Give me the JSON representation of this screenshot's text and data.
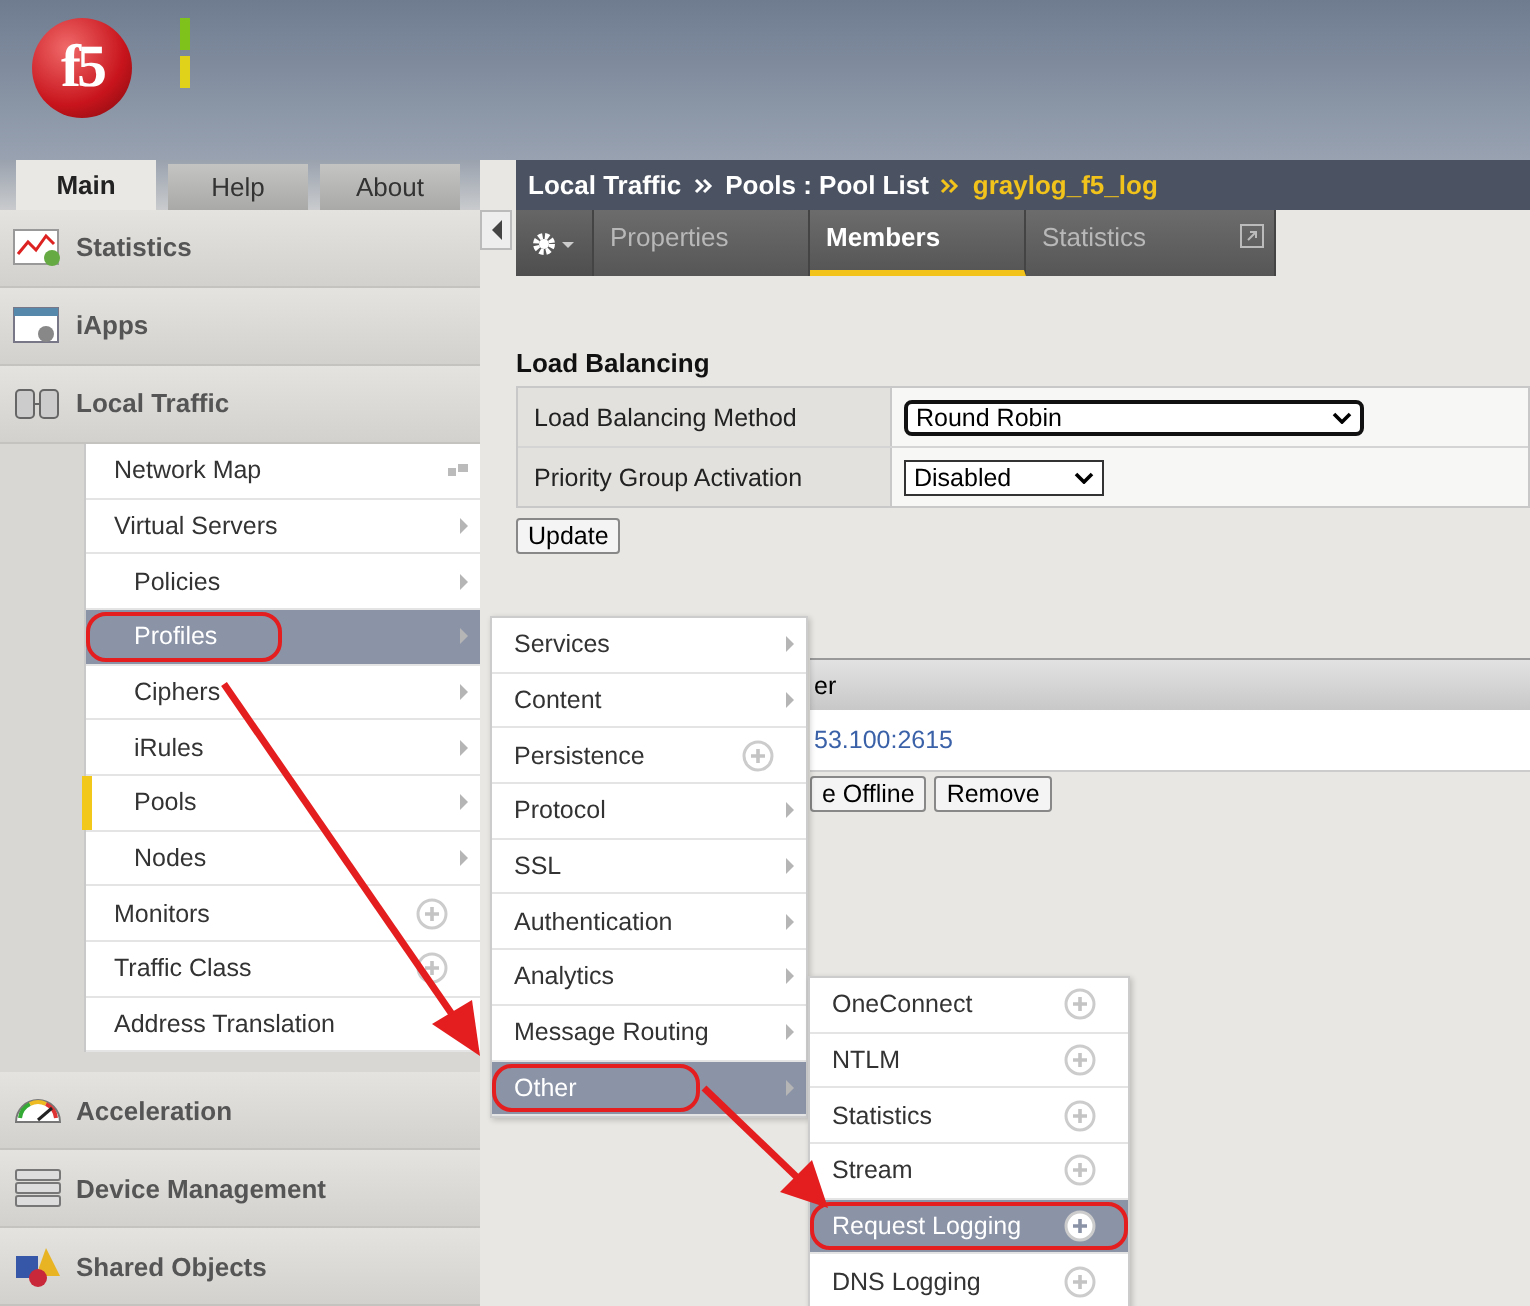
{
  "header": {
    "logo": "f5",
    "status_lights": [
      {
        "color": "#7fc21c"
      },
      {
        "color": "#e0d21a"
      }
    ]
  },
  "nav_tabs": [
    {
      "label": "Main",
      "selected": true
    },
    {
      "label": "Help",
      "selected": false
    },
    {
      "label": "About",
      "selected": false
    }
  ],
  "sidebar": {
    "sections_top": [
      {
        "label": "Statistics"
      },
      {
        "label": "iApps"
      },
      {
        "label": "Local Traffic"
      }
    ],
    "local_traffic_items": [
      {
        "label": "Network Map",
        "kind": "map",
        "selected": false,
        "current": false,
        "highlighted": false
      },
      {
        "label": "Virtual Servers",
        "kind": "arrow",
        "selected": false,
        "current": false,
        "highlighted": false,
        "children": [
          {
            "label": "Policies",
            "kind": "arrow",
            "selected": false,
            "current": false,
            "highlighted": false
          },
          {
            "label": "Profiles",
            "kind": "arrow",
            "selected": true,
            "current": false,
            "highlighted": true
          },
          {
            "label": "Ciphers",
            "kind": "arrow",
            "selected": false,
            "current": false,
            "highlighted": false
          },
          {
            "label": "iRules",
            "kind": "arrow",
            "selected": false,
            "current": false,
            "highlighted": false
          },
          {
            "label": "Pools",
            "kind": "arrow",
            "selected": false,
            "current": true,
            "highlighted": false
          },
          {
            "label": "Nodes",
            "kind": "arrow",
            "selected": false,
            "current": false,
            "highlighted": false
          }
        ]
      },
      {
        "label": "Monitors",
        "kind": "plus",
        "selected": false,
        "current": false,
        "highlighted": false
      },
      {
        "label": "Traffic Class",
        "kind": "plus",
        "selected": false,
        "current": false,
        "highlighted": false
      },
      {
        "label": "Address Translation",
        "kind": "none",
        "selected": false,
        "current": false,
        "highlighted": false
      }
    ],
    "sections_bottom": [
      {
        "label": "Acceleration"
      },
      {
        "label": "Device Management"
      },
      {
        "label": "Shared Objects"
      }
    ]
  },
  "breadcrumb": [
    {
      "label": "Local Traffic",
      "kind": "crumb"
    },
    {
      "label": "Pools : Pool List",
      "kind": "crumb"
    },
    {
      "label": "graylog_f5_log",
      "kind": "current"
    }
  ],
  "page_tabs": [
    {
      "label": "Properties",
      "selected": false
    },
    {
      "label": "Members",
      "selected": true
    },
    {
      "label": "Statistics",
      "selected": false
    }
  ],
  "load_balancing": {
    "title": "Load Balancing",
    "rows": [
      {
        "label": "Load Balancing Method",
        "value": "Round Robin",
        "kind": "wide"
      },
      {
        "label": "Priority Group Activation",
        "value": "Disabled",
        "kind": "narrow"
      }
    ],
    "button": "Update"
  },
  "members": {
    "column_1": "er",
    "row_value": "53.100:2615",
    "buttons": [
      "e Offline",
      "Remove"
    ]
  },
  "profiles_menu": [
    {
      "label": "Services",
      "kind": "arrow",
      "selected": false,
      "highlighted": false
    },
    {
      "label": "Content",
      "kind": "arrow",
      "selected": false,
      "highlighted": false
    },
    {
      "label": "Persistence",
      "kind": "plus",
      "selected": false,
      "highlighted": false
    },
    {
      "label": "Protocol",
      "kind": "arrow",
      "selected": false,
      "highlighted": false
    },
    {
      "label": "SSL",
      "kind": "arrow",
      "selected": false,
      "highlighted": false
    },
    {
      "label": "Authentication",
      "kind": "arrow",
      "selected": false,
      "highlighted": false
    },
    {
      "label": "Analytics",
      "kind": "arrow",
      "selected": false,
      "highlighted": false
    },
    {
      "label": "Message Routing",
      "kind": "arrow",
      "selected": false,
      "highlighted": false
    },
    {
      "label": "Other",
      "kind": "arrow",
      "selected": true,
      "highlighted": true
    }
  ],
  "other_menu": [
    {
      "label": "OneConnect",
      "kind": "plus",
      "selected": false,
      "highlighted": false
    },
    {
      "label": "NTLM",
      "kind": "plus",
      "selected": false,
      "highlighted": false
    },
    {
      "label": "Statistics",
      "kind": "plus",
      "selected": false,
      "highlighted": false
    },
    {
      "label": "Stream",
      "kind": "plus",
      "selected": false,
      "highlighted": false
    },
    {
      "label": "Request Logging",
      "kind": "plus",
      "selected": true,
      "highlighted": true
    },
    {
      "label": "DNS Logging",
      "kind": "plus",
      "selected": false,
      "highlighted": false
    }
  ]
}
